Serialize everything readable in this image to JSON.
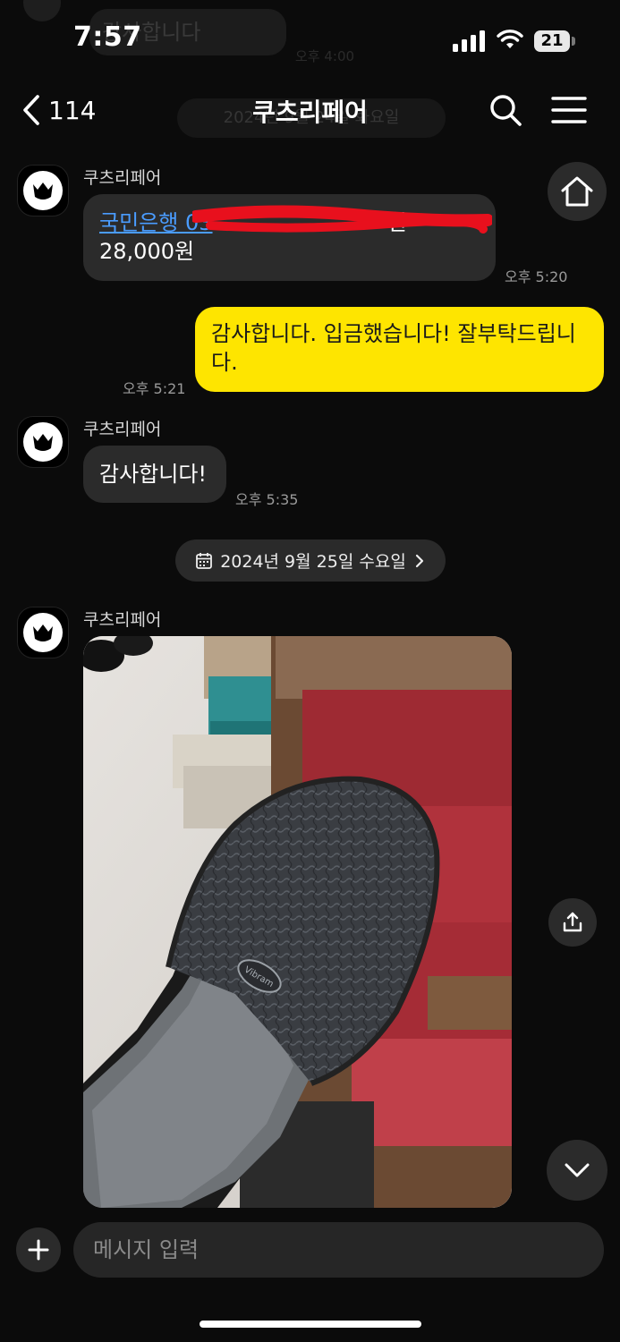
{
  "status_bar": {
    "time": "7:57",
    "battery": "21"
  },
  "ghost": {
    "top_bubble": "감사합니다",
    "time": "오후 4:00",
    "date": "2024년 9월 24일 화요일"
  },
  "header": {
    "back_count": "114",
    "title": "쿠츠리페어"
  },
  "messages": [
    {
      "sender": "쿠츠리페어",
      "bank_link": "국민은행 03",
      "bank_suffix": "환",
      "amount": "28,000원",
      "time": "오후 5:20"
    },
    {
      "text": "감사합니다. 입금했습니다! 잘부탁드립니다.",
      "time": "오후 5:21"
    },
    {
      "sender": "쿠츠리페어",
      "text": "감사합니다!",
      "time": "오후 5:35"
    }
  ],
  "date_separator": {
    "label": "2024년 9월 25일 수요일"
  },
  "photo_message": {
    "sender": "쿠츠리페어",
    "sole_brand": "Vibram"
  },
  "input": {
    "placeholder": "메시지 입력"
  },
  "colors": {
    "accent_yellow": "#fee500",
    "bubble_dark": "#2b2b2b",
    "link_blue": "#4a9cff",
    "background": "#0b0b0b"
  }
}
